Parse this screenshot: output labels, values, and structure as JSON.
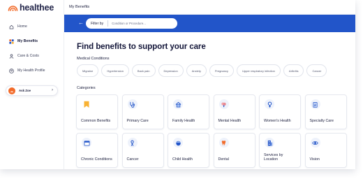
{
  "app": {
    "brand": "healthee"
  },
  "sidebar": {
    "items": [
      {
        "label": "Home",
        "icon": "home-icon",
        "active": false
      },
      {
        "label": "My Benefits",
        "icon": "grid-icon",
        "active": true
      },
      {
        "label": "Care & Costs",
        "icon": "person-icon",
        "active": false
      },
      {
        "label": "My Health Profile",
        "icon": "profile-icon",
        "active": false
      }
    ],
    "ask_zoe": {
      "label": "Ask Zoe",
      "chevron": "›"
    }
  },
  "header": {
    "title": "My Benefits"
  },
  "filter": {
    "back": "←",
    "label": "Filter by",
    "placeholder": "Condition or Procedure..."
  },
  "main": {
    "title": "Find benefits to support your care",
    "medical_conditions_label": "Medical Conditions",
    "conditions": [
      "Migraine",
      "Hypertension",
      "Back pain",
      "Depression",
      "Anxiety",
      "Pregnancy",
      "Upper respiratory infection",
      "Arthritis",
      "Cancer"
    ],
    "categories_label": "Categories",
    "categories": [
      {
        "label": "Common Benefits",
        "icon": "bookmark-icon"
      },
      {
        "label": "Primary Care",
        "icon": "stethoscope-icon"
      },
      {
        "label": "Family Health",
        "icon": "house-icon"
      },
      {
        "label": "Mental Health",
        "icon": "brain-icon"
      },
      {
        "label": "Women's Health",
        "icon": "female-symbol-icon"
      },
      {
        "label": "Specialty Care",
        "icon": "clipboard-icon"
      },
      {
        "label": "Chronic Conditions",
        "icon": "calendar-icon"
      },
      {
        "label": "Cancer",
        "icon": "ribbon-icon"
      },
      {
        "label": "Child Health",
        "icon": "baby-icon"
      },
      {
        "label": "Dental",
        "icon": "tooth-icon"
      },
      {
        "label": "Services by Location",
        "icon": "building-icon"
      },
      {
        "label": "Vision",
        "icon": "eye-icon"
      }
    ]
  },
  "colors": {
    "brand_orange": "#f26b2a",
    "accent_blue": "#2255c9",
    "text_dark": "#1b1e3d"
  }
}
